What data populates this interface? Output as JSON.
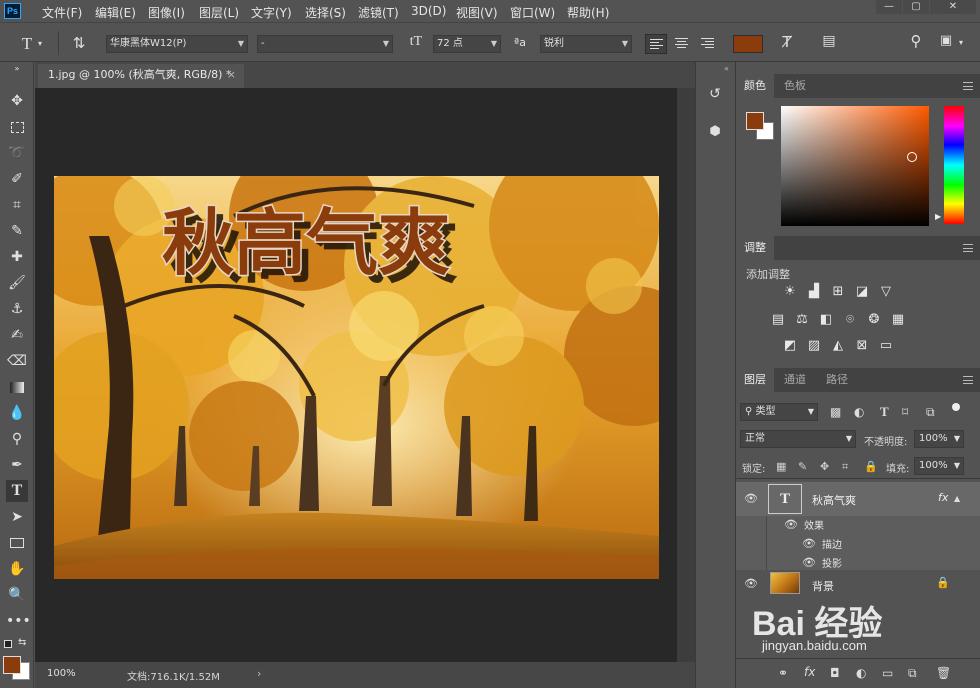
{
  "app": {
    "logo": "Ps"
  },
  "menu": [
    "文件(F)",
    "编辑(E)",
    "图像(I)",
    "图层(L)",
    "文字(Y)",
    "选择(S)",
    "滤镜(T)",
    "3D(D)",
    "视图(V)",
    "窗口(W)",
    "帮助(H)"
  ],
  "window_controls": [
    "—",
    "▢",
    "✕"
  ],
  "options": {
    "font_family": "华康黑体W12(P)",
    "font_style": "-",
    "font_size": "72 点",
    "antialias": "锐利",
    "text_color": "#8B3C0C"
  },
  "document": {
    "tab_title": "1.jpg @ 100% (秋高气爽, RGB/8) *",
    "close_glyph": "×",
    "canvas_text": "秋高气爽",
    "zoom": "100%",
    "doc_size": "文档:716.1K/1.52M",
    "text_color": "#8B3C0C"
  },
  "color_panel": {
    "tabs": [
      "颜色",
      "色板"
    ],
    "foreground": "#8B3C0C",
    "background": "#FFFFFF",
    "hue_color": "#FF5A00"
  },
  "adjustments_panel": {
    "tab": "调整",
    "subtitle": "添加调整"
  },
  "layers_panel": {
    "tabs": [
      "图层",
      "通道",
      "路径"
    ],
    "filter_kind": "类型",
    "blend_mode": "正常",
    "opacity_label": "不透明度:",
    "opacity": "100%",
    "lock_label": "锁定:",
    "fill_label": "填充:",
    "fill": "100%",
    "layers": [
      {
        "name": "秋高气爽",
        "type": "text",
        "fx": "fx"
      },
      {
        "name": "效果"
      },
      {
        "name": "描边"
      },
      {
        "name": "投影"
      },
      {
        "name": "背景",
        "type": "image"
      }
    ],
    "footer_fx": "fx"
  },
  "watermark": {
    "brand": "Bai 经验",
    "url": "jingyan.baidu.com"
  }
}
